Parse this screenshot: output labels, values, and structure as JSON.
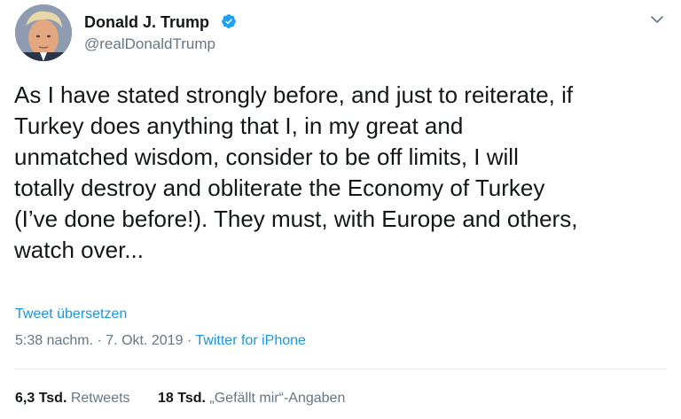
{
  "author": {
    "display_name": "Donald J. Trump",
    "handle": "@realDonaldTrump",
    "verified": true
  },
  "tweet": {
    "text_lines": [
      "As I have stated strongly before, and just to reiterate, if",
      "Turkey does anything that I, in my great and",
      "unmatched wisdom, consider to be off limits, I will",
      "totally destroy and obliterate the Economy of Turkey",
      "(I’ve done before!). They must, with Europe and others,",
      "watch over..."
    ],
    "translate_label": "Tweet übersetzen",
    "time": "5:38 nachm.",
    "date": "7. Okt. 2019",
    "separator": "·",
    "source": "Twitter for iPhone"
  },
  "stats": {
    "retweets_count": "6,3 Tsd.",
    "retweets_label": "Retweets",
    "likes_count": "18 Tsd.",
    "likes_label": "„Gefällt mir“-Angaben"
  },
  "icons": {
    "verified": "verified-badge-icon",
    "menu": "chevron-down-icon"
  },
  "colors": {
    "link": "#1b95e0",
    "secondary_text": "#657786",
    "primary_text": "#14171a",
    "verified_badge": "#1da1f2"
  }
}
